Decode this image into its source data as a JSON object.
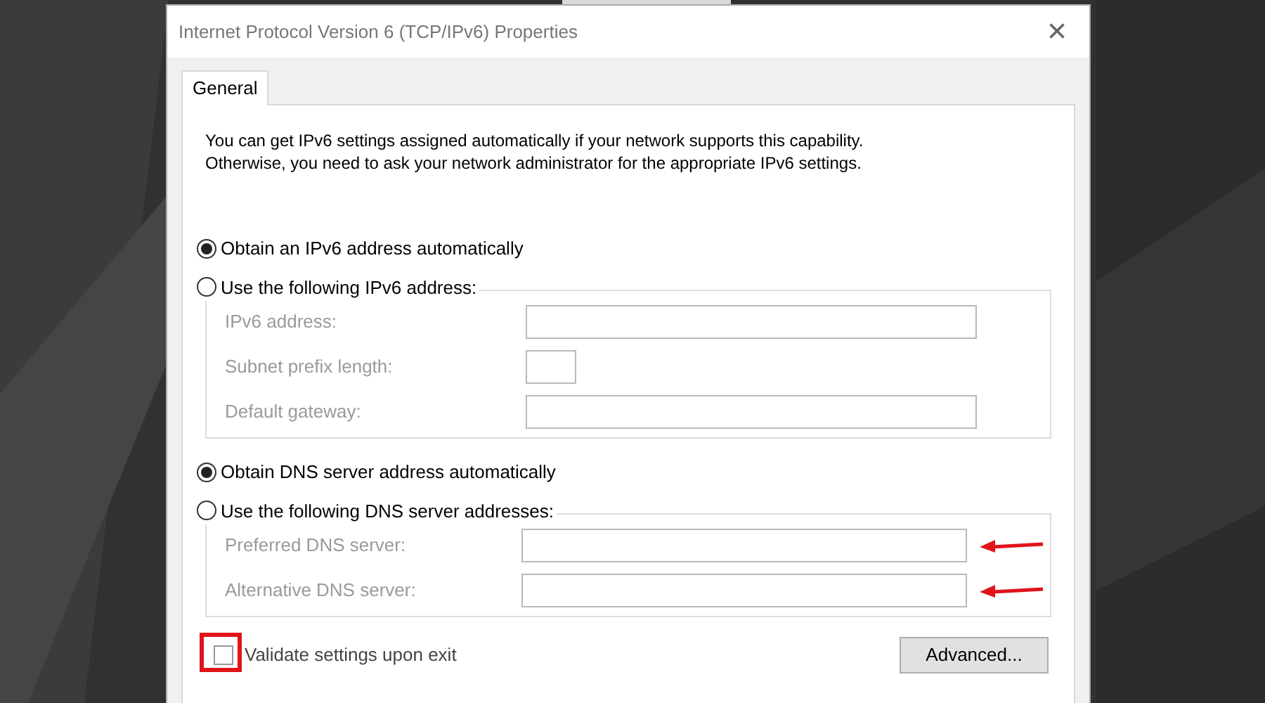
{
  "window": {
    "title": "Internet Protocol Version 6 (TCP/IPv6) Properties",
    "close": "×"
  },
  "tabs": [
    {
      "label": "General",
      "selected": true
    }
  ],
  "description": [
    "You can get IPv6 settings assigned automatically if your network supports this capability.",
    "Otherwise, you need to ask your network administrator for the appropriate IPv6 settings."
  ],
  "address_section": {
    "options": [
      {
        "label": "Obtain an IPv6 address automatically",
        "selected": true
      },
      {
        "label": "Use the following IPv6 address:",
        "selected": false
      }
    ],
    "fields": [
      {
        "label": "IPv6 address:",
        "kind": "wide",
        "disabled": true
      },
      {
        "label": "Subnet prefix length:",
        "kind": "short",
        "disabled": true
      },
      {
        "label": "Default gateway:",
        "kind": "wide",
        "disabled": true
      }
    ]
  },
  "dns_section": {
    "options": [
      {
        "label": "Obtain DNS server address automatically",
        "selected": true
      },
      {
        "label": "Use the following DNS server addresses:",
        "selected": false
      }
    ],
    "fields": [
      {
        "label": "Preferred DNS server:",
        "kind": "wide",
        "disabled": true,
        "marked": true
      },
      {
        "label": "Alternative DNS server:",
        "kind": "wide",
        "disabled": true,
        "marked": true
      }
    ]
  },
  "validate": {
    "label": "Validate settings upon exit",
    "checked": false,
    "highlighted": true
  },
  "buttons": [
    "Advanced..."
  ]
}
